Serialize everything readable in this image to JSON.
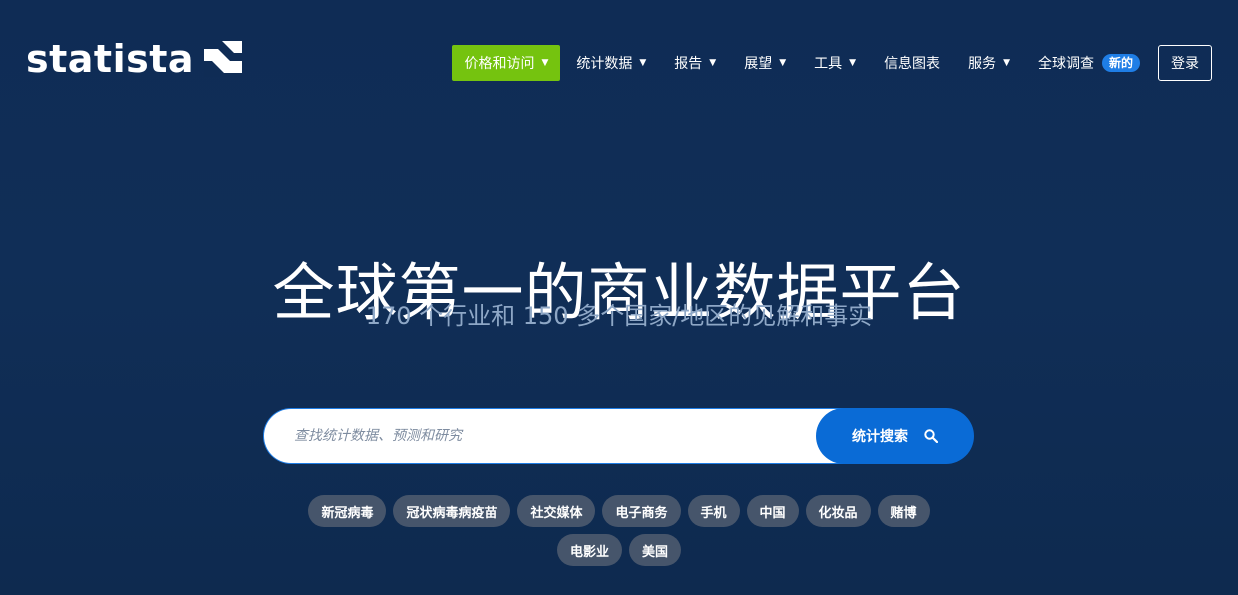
{
  "brand": {
    "name": "statista"
  },
  "nav": {
    "items": [
      {
        "label": "价格和访问",
        "has_caret": true,
        "style": "primary"
      },
      {
        "label": "统计数据",
        "has_caret": true
      },
      {
        "label": "报告",
        "has_caret": true
      },
      {
        "label": "展望",
        "has_caret": true
      },
      {
        "label": "工具",
        "has_caret": true
      },
      {
        "label": "信息图表",
        "has_caret": false
      },
      {
        "label": "服务",
        "has_caret": true
      },
      {
        "label": "全球调查",
        "has_caret": false,
        "badge": "新的"
      }
    ],
    "login_label": "登录"
  },
  "hero": {
    "title": "全球第一的商业数据平台",
    "subtitle": "170 个行业和 150 多个国家/地区的见解和事实"
  },
  "search": {
    "placeholder": "查找统计数据、预测和研究",
    "button_label": "统计搜索"
  },
  "tags": [
    "新冠病毒",
    "冠状病毒病疫苗",
    "社交媒体",
    "电子商务",
    "手机",
    "中国",
    "化妆品",
    "赌博",
    "电影业",
    "美国"
  ],
  "colors": {
    "background": "#0f2c55",
    "primary_nav": "#75c30f",
    "accent": "#1f7ee6",
    "search_button": "#0a6bd6",
    "tag_bg": "#46556b",
    "subtitle": "#8ea7c6"
  }
}
